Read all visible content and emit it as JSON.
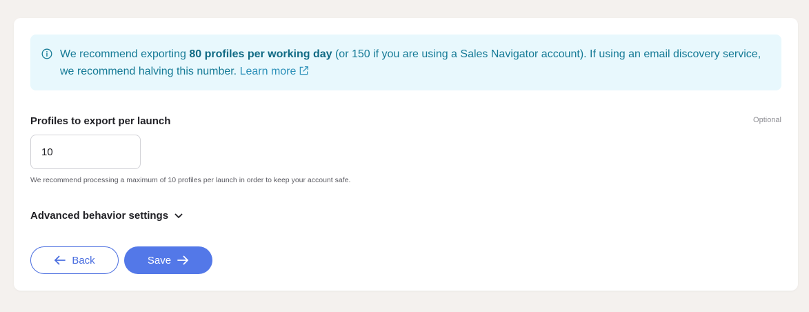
{
  "banner": {
    "text_before": "We recommend exporting ",
    "text_bold": "80 profiles per working day",
    "text_after": " (or 150 if you are using a Sales Navigator account). If using an email discovery service, we recommend halving this number. ",
    "link_label": "Learn more",
    "icon": "info-icon",
    "link_icon": "external-link-icon"
  },
  "field": {
    "label": "Profiles to export per launch",
    "optional_label": "Optional",
    "value": "10",
    "hint": "We recommend processing a maximum of 10 profiles per launch in order to keep your account safe."
  },
  "advanced": {
    "label": "Advanced behavior settings",
    "icon": "chevron-down-icon"
  },
  "actions": {
    "back_label": "Back",
    "save_label": "Save"
  },
  "colors": {
    "banner_bg": "#e8f8fd",
    "banner_text": "#157a96",
    "primary": "#5378e8",
    "page_bg": "#f4f1ee"
  }
}
